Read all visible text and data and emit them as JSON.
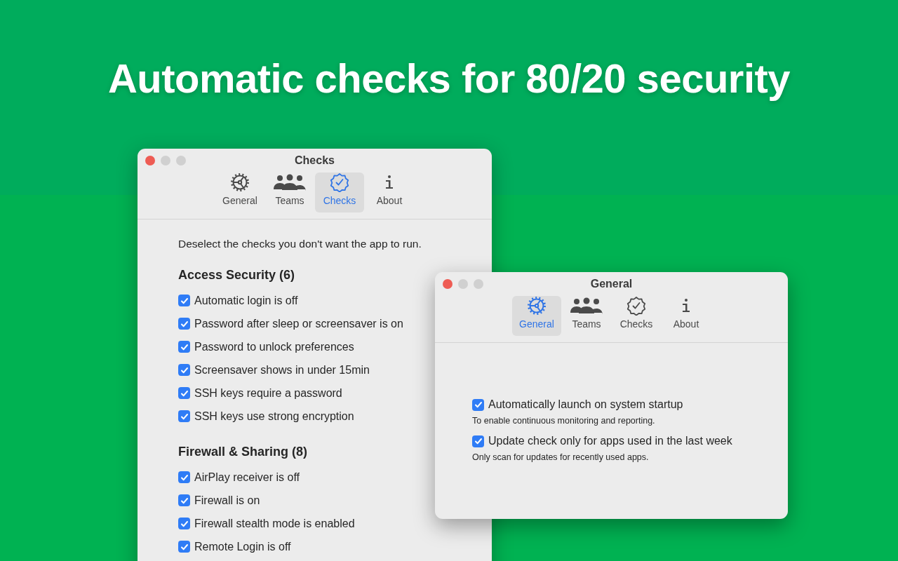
{
  "headline": "Automatic checks for 80/20 security",
  "checks_window": {
    "title": "Checks",
    "tabs": [
      {
        "label": "General",
        "selected": false
      },
      {
        "label": "Teams",
        "selected": false
      },
      {
        "label": "Checks",
        "selected": true
      },
      {
        "label": "About",
        "selected": false
      }
    ],
    "intro": "Deselect the checks you don't want the app to run.",
    "sections": [
      {
        "heading": "Access Security (6)",
        "items": [
          {
            "label": "Automatic login is off",
            "checked": true
          },
          {
            "label": "Password after sleep or screensaver is on",
            "checked": true
          },
          {
            "label": "Password to unlock preferences",
            "checked": true
          },
          {
            "label": "Screensaver shows in under 15min",
            "checked": true
          },
          {
            "label": "SSH keys require a password",
            "checked": true
          },
          {
            "label": "SSH keys use strong encryption",
            "checked": true
          }
        ]
      },
      {
        "heading": "Firewall & Sharing (8)",
        "items": [
          {
            "label": "AirPlay receiver is off",
            "checked": true
          },
          {
            "label": "Firewall is on",
            "checked": true
          },
          {
            "label": "Firewall stealth mode is enabled",
            "checked": true
          },
          {
            "label": "Remote Login is off",
            "checked": true
          }
        ]
      }
    ]
  },
  "general_window": {
    "title": "General",
    "tabs": [
      {
        "label": "General",
        "selected": true
      },
      {
        "label": "Teams",
        "selected": false
      },
      {
        "label": "Checks",
        "selected": false
      },
      {
        "label": "About",
        "selected": false
      }
    ],
    "options": [
      {
        "label": "Automatically launch on system startup",
        "checked": true,
        "description": "To enable continuous monitoring and reporting."
      },
      {
        "label": "Update check only for apps used in the last week",
        "checked": true,
        "description": "Only scan for updates for recently used apps."
      }
    ]
  }
}
